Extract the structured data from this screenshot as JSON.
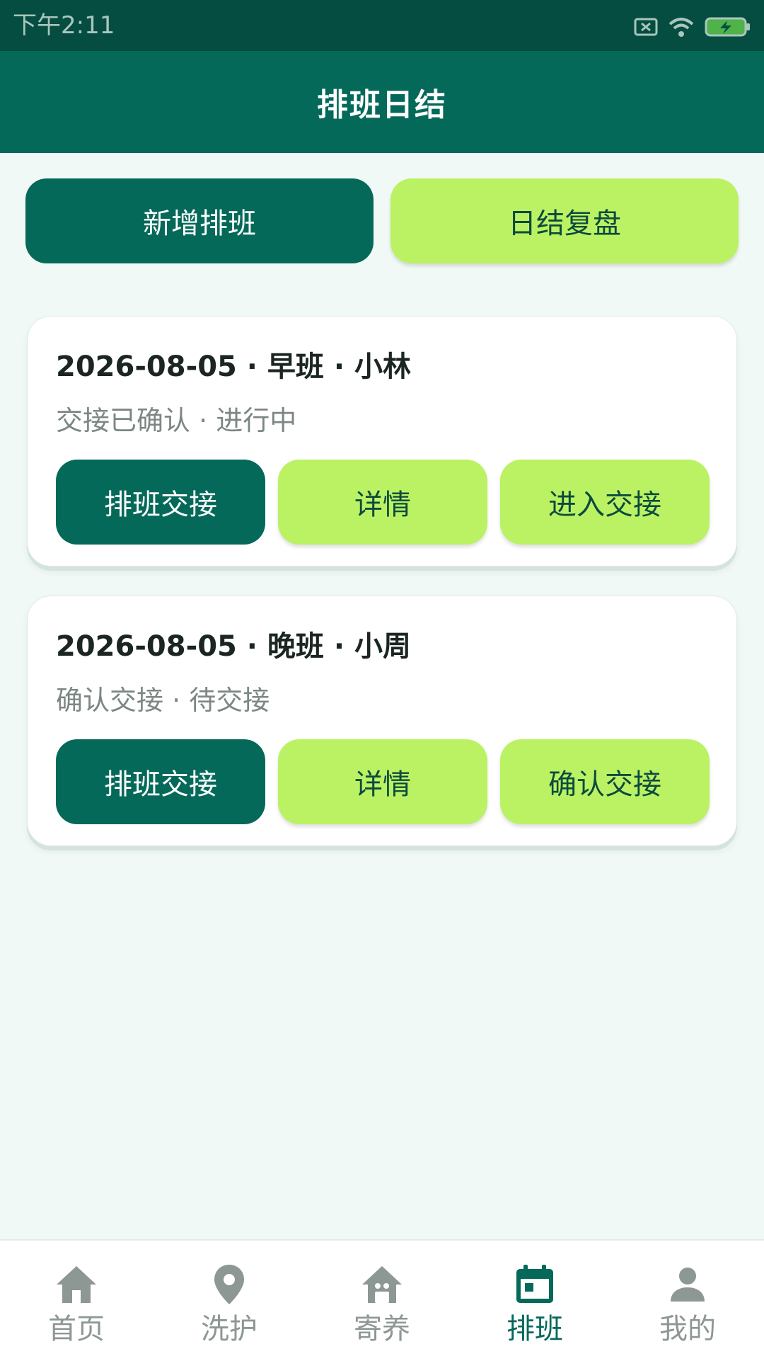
{
  "status_bar": {
    "time": "下午2:11"
  },
  "app_bar": {
    "title": "排班日结"
  },
  "actions": {
    "add_shift": "新增排班",
    "daily_review": "日结复盘"
  },
  "cards": [
    {
      "title": "2026-08-05 · 早班 · 小林",
      "subtitle": "交接已确认 · 进行中",
      "buttons": [
        "排班交接",
        "详情",
        "进入交接"
      ]
    },
    {
      "title": "2026-08-05 · 晚班 · 小周",
      "subtitle": "确认交接 · 待交接",
      "buttons": [
        "排班交接",
        "详情",
        "确认交接"
      ]
    }
  ],
  "bottom_nav": {
    "items": [
      {
        "label": "首页",
        "icon": "home-icon"
      },
      {
        "label": "洗护",
        "icon": "location-pin-icon"
      },
      {
        "label": "寄养",
        "icon": "boarding-house-icon"
      },
      {
        "label": "排班",
        "icon": "calendar-icon",
        "active": true
      },
      {
        "label": "我的",
        "icon": "person-icon"
      }
    ]
  },
  "colors": {
    "primary": "#05695a",
    "accent_lime": "#bbf264",
    "background": "#f1f9f6",
    "status_bar": "#054d40"
  }
}
